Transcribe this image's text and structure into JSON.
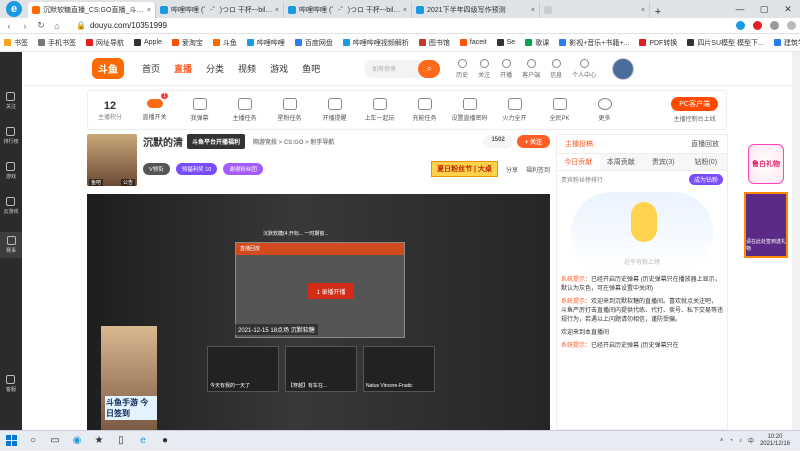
{
  "browser": {
    "tabs": [
      {
        "title": "沉默软糖直播_CS:GO直播_斗鱼直",
        "color": "#ff6a00",
        "active": true
      },
      {
        "title": "哔哩哔哩 (゜-゜)つロ 干杯~-bilibili",
        "color": "#1a9ae3",
        "active": false
      },
      {
        "title": "哔哩哔哩 (゜-゜)つロ 干杯~-bilibili",
        "color": "#1a9ae3",
        "active": false
      },
      {
        "title": "2021下半年四级写作预测",
        "color": "#1a9ae3",
        "active": false
      },
      {
        "title": "",
        "color": "#ccc",
        "active": false
      }
    ],
    "new_tab": "+",
    "url": "douyu.com/10351999",
    "bookmarks": [
      "书签",
      "手机书签",
      "网址导航",
      "Apple",
      "爱淘宝",
      "斗鱼",
      "哔哩哔哩",
      "百度网盘",
      "哔哩哔哩视频解析",
      "图书馆",
      "faceit",
      "Se",
      "歌课",
      "影视+音乐+书籍+...",
      "PDF转换",
      "四片SU模型 模型下...",
      "建筑学长——千万..."
    ],
    "bookmark_colors": [
      "#f5a623",
      "#777",
      "#e02020",
      "#333",
      "#ff5000",
      "#ff6a00",
      "#1a9ae3",
      "#2b7de9",
      "#1a9ae3",
      "#c0392b",
      "#ff5500",
      "#333",
      "#00a651",
      "#2b7de9",
      "#e02020",
      "#333",
      "#2b7de9"
    ]
  },
  "sidebar": {
    "items": [
      {
        "label": "关注"
      },
      {
        "label": "排行榜"
      },
      {
        "label": "游戏"
      },
      {
        "label": "云游戏"
      },
      {
        "label": "赛事"
      },
      {
        "label": "客服"
      }
    ]
  },
  "header": {
    "logo": "斗鱼",
    "nav": [
      "首页",
      "直播",
      "分类",
      "视频",
      "游戏",
      "鱼吧"
    ],
    "nav_active": 1,
    "search_placeholder": "如有你来",
    "icons": [
      "历史",
      "关注",
      "开播",
      "客户端",
      "信息",
      "个人中心"
    ]
  },
  "toolbar": {
    "count": "12",
    "count_label": "主播积分",
    "badge": "1",
    "items": [
      "直播开关",
      "我弹幕",
      "主播任务",
      "星粉任务",
      "开播提醒",
      "上车一起玩",
      "充能任务",
      "设置直播密码",
      "火力全开",
      "全民PK",
      "更多"
    ],
    "pc_client": "PC客户端",
    "pc_sub": "主播控制台上线"
  },
  "streamer": {
    "name": "沉默的清",
    "tooltip": "斗鱼平台开播福利",
    "category_text": "网游竞技 > CS:GO > 射手导航",
    "avatar_tags": [
      "鱼吧",
      "公告"
    ],
    "followers": "1502",
    "follow_label": "+ 关注",
    "levels": [
      {
        "label": "V领衔",
        "color": "#555"
      },
      {
        "label": "领福利奖 10",
        "color": "#7a4cff"
      },
      {
        "label": "谢谢粉丝团",
        "color": "#a45bff"
      }
    ],
    "promo": "夏日粉丝节 | 大桌",
    "share": "分享",
    "more": "福利签到"
  },
  "video": {
    "window_title": "沉默软糖(4.开标... 一时期窗...",
    "stream_header": "直播回放",
    "play_label": "1 录播开播",
    "timestamp": "2021-12-15 18点场 沉默软糖",
    "thumb_captions": [
      "今天有我的一天了",
      "【穿越】有车在...",
      "Natus Vincere-Fnatic"
    ],
    "ad_text": "斗鱼手游 今日签到"
  },
  "rank": {
    "top_tabs": [
      "主播投稿",
      "直播回放"
    ],
    "sub_tabs": [
      "今日贡献",
      "本周贡献",
      "贵宾(3)",
      "钻粉(0)"
    ],
    "line": "贵宾粉丝榜排行",
    "line_badge": "成为钻粉",
    "mascot_text": "近乎有粉上榜",
    "chat": [
      {
        "prefix": "系统提示：",
        "text": "已经开启历史弹幕 (历史弹幕只在播放器上显示，默认为灰色，可在弹幕设置中关闭)"
      },
      {
        "prefix": "系统提示：",
        "text": "欢迎来到沉默软糖的直播间。喜欢就点关注吧，斗鱼严厉打击直播间内提供代练、代打、卖号、私下交易等违规行为，若遇以上问题请勿相信，谨防受骗。"
      },
      {
        "prefix": "",
        "text": "欢迎来到本直播间"
      },
      {
        "prefix": "系统提示：",
        "text": "已经开启历史弹幕 (历史弹幕只在"
      }
    ]
  },
  "right_ads": [
    "鲁白礼物",
    "请在此处签到送礼物"
  ],
  "taskbar": {
    "time": "10:20",
    "date": "2021/12/16"
  }
}
